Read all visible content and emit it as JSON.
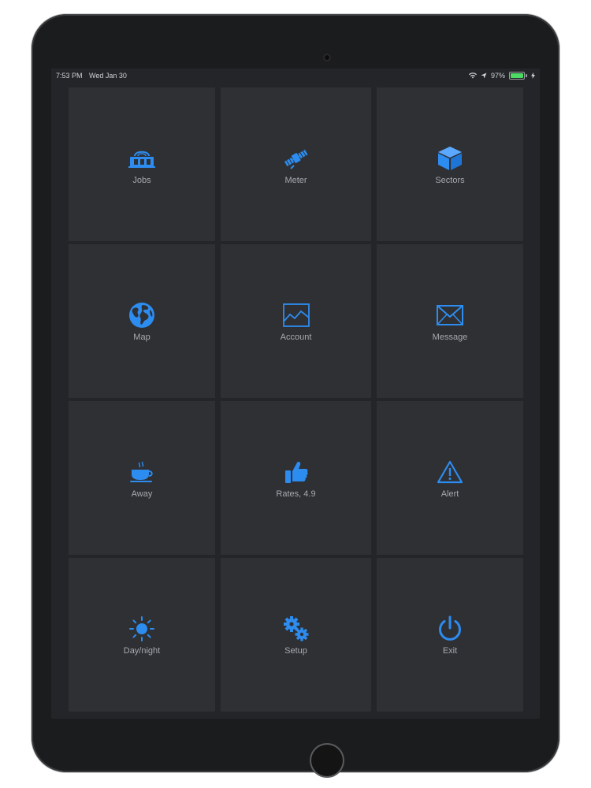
{
  "status_bar": {
    "time": "7:53 PM",
    "date": "Wed Jan 30",
    "battery": "97%",
    "battery_level": 0.97
  },
  "accent_color": "#2d8cf0",
  "tiles": [
    {
      "label": "Jobs",
      "icon": "jobs-icon"
    },
    {
      "label": "Meter",
      "icon": "satellite-icon"
    },
    {
      "label": "Sectors",
      "icon": "cube-icon"
    },
    {
      "label": "Map",
      "icon": "globe-icon"
    },
    {
      "label": "Account",
      "icon": "chart-icon"
    },
    {
      "label": "Message",
      "icon": "envelope-icon"
    },
    {
      "label": "Away",
      "icon": "coffee-cup-icon"
    },
    {
      "label": "Rates, 4.9",
      "icon": "thumbs-up-icon"
    },
    {
      "label": "Alert",
      "icon": "warning-icon"
    },
    {
      "label": "Day/night",
      "icon": "sun-icon"
    },
    {
      "label": "Setup",
      "icon": "gears-icon"
    },
    {
      "label": "Exit",
      "icon": "power-icon"
    }
  ]
}
